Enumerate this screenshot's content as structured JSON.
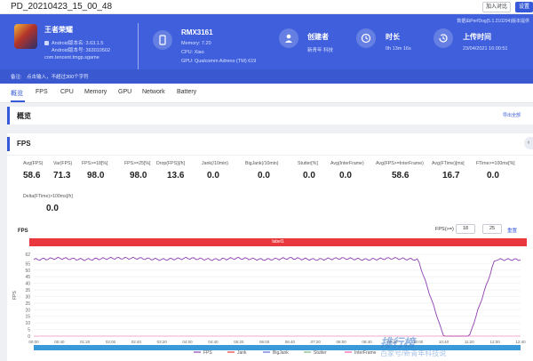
{
  "window": {
    "title": "PD_20210423_15_00_48",
    "compare_label": "加入对比",
    "settings_label": "设置"
  },
  "header": {
    "version": "数据由PerfDog(5.1.210204)版本提供",
    "app": {
      "name": "王者荣耀",
      "android_version": "Android版本名: 3.63.1.5",
      "android_code": "Android版本号: 363010502",
      "package": "com.tencent.tmgp.sgame"
    },
    "device": {
      "name": "RMX3161",
      "memory": "Memory: 7.20",
      "cpu": "CPU: Xiao",
      "gpu": "GPU: Qualcomm Adreno (TM) 619"
    },
    "creator": {
      "label": "创建者",
      "value": "新青年 科技"
    },
    "duration": {
      "label": "时长",
      "value": "0h 13m 16s"
    },
    "upload": {
      "label": "上传时间",
      "value": "23/04/2021 16:00:51"
    },
    "note": {
      "label": "备注:",
      "placeholder": "点击输入，不超过300个字符"
    }
  },
  "tabs": [
    "概览",
    "FPS",
    "CPU",
    "Memory",
    "GPU",
    "Network",
    "Battery"
  ],
  "overview": {
    "title": "概览",
    "export_label": "导出全部"
  },
  "fps_section": {
    "title": "FPS",
    "metrics": [
      {
        "label": "Avg(FPS)",
        "value": "58.6"
      },
      {
        "label": "Var(FPS)",
        "value": "71.3"
      },
      {
        "label": "FPS>=18[%]",
        "value": "98.0"
      },
      {
        "label": "FPS>=25[%]",
        "value": "98.0"
      },
      {
        "label": "Drop(FPS)[/h]",
        "value": "13.6"
      },
      {
        "label": "Jank(/10min)",
        "value": "0.0"
      },
      {
        "label": "BigJank(/10min)",
        "value": "0.0"
      },
      {
        "label": "Stutter[%]",
        "value": "0.0"
      },
      {
        "label": "Avg(InterFrame)",
        "value": "0.0"
      },
      {
        "label": "Avg(FPS>=InterFrame)",
        "value": "58.6"
      },
      {
        "label": "Avg(FTime)[ms]",
        "value": "16.7"
      },
      {
        "label": "FTime>=100ms[%]",
        "value": "0.0"
      },
      {
        "label": "Delta(FTime)>100ms[/h]",
        "value": "0.0"
      }
    ],
    "chart_title": "FPS",
    "fps_threshold_label": "FPS(>=)",
    "fps_threshold_a": "18",
    "fps_threshold_b": "25",
    "reset_label": "重置",
    "label_bar": "label1"
  },
  "chart_data": {
    "type": "line",
    "ylabel": "FPS",
    "ylim": [
      0,
      62
    ],
    "yticks": [
      0,
      5,
      10,
      15,
      20,
      25,
      30,
      35,
      40,
      45,
      50,
      55,
      62
    ],
    "x": [
      "00:00",
      "00:40",
      "01:20",
      "02:00",
      "02:40",
      "03:20",
      "04:00",
      "04:40",
      "05:20",
      "06:00",
      "06:40",
      "07:20",
      "08:00",
      "08:40",
      "09:20",
      "10:00",
      "10:40",
      "11:20",
      "12:00",
      "12:40"
    ],
    "legend": [
      "FPS",
      "Jank",
      "BigJank",
      "Stutter",
      "InterFrame"
    ],
    "series": [
      {
        "name": "FPS",
        "color": "#8e3fb0",
        "values": [
          58,
          59,
          58,
          59,
          59,
          58,
          59,
          58,
          59,
          58,
          59,
          58,
          59,
          58,
          59,
          58,
          0,
          0,
          58,
          58
        ]
      },
      {
        "name": "InterFrame",
        "color": "#f15fa4",
        "values": [
          0,
          0,
          0,
          0,
          0,
          0,
          0,
          0,
          0,
          0,
          0,
          0,
          0,
          0,
          0,
          0,
          0,
          0,
          0,
          0
        ]
      }
    ],
    "legend_colors": [
      "#8e3fb0",
      "#e8383d",
      "#5b6bd6",
      "#7ab77a",
      "#f15fa4"
    ]
  },
  "watermark": {
    "text": "排行榜",
    "sub": "百家号/新青年科技说"
  }
}
